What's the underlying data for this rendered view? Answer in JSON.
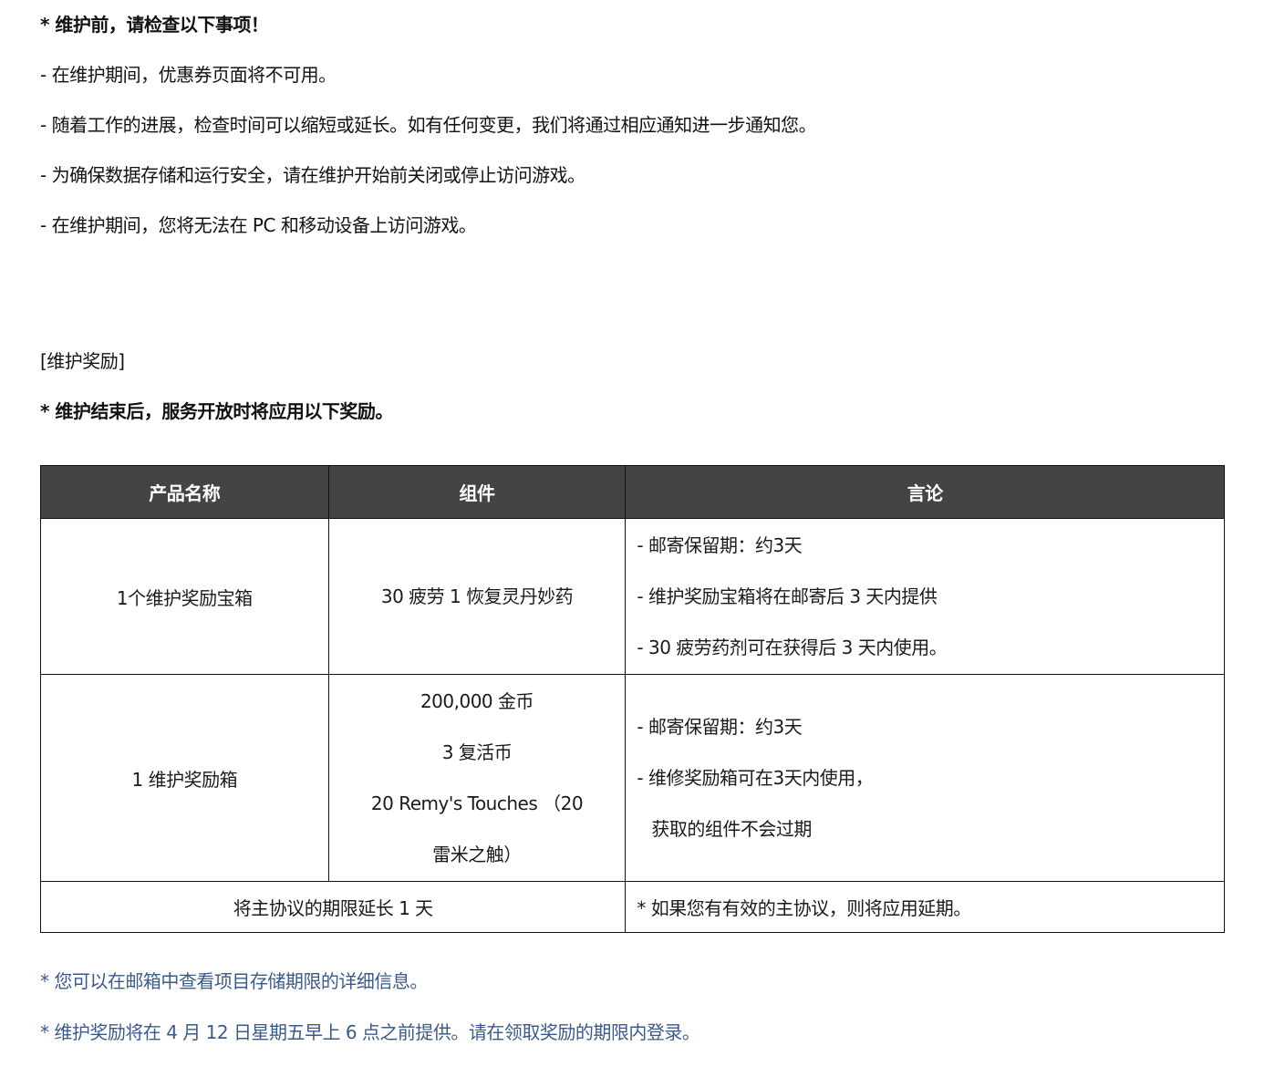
{
  "notice": {
    "heading": "* 维护前，请检查以下事项！",
    "items": [
      "- 在维护期间，优惠券页面将不可用。",
      "- 随着工作的进展，检查时间可以缩短或延长。如有任何变更，我们将通过相应通知进一步通知您。",
      "- 为确保数据存储和运行安全，请在维护开始前关闭或停止访问游戏。",
      "- 在维护期间，您将无法在 PC 和移动设备上访问游戏。"
    ]
  },
  "rewards": {
    "section_title": "[维护奖励]",
    "intro": "* 维护结束后，服务开放时将应用以下奖励。",
    "table": {
      "headers": [
        "产品名称",
        "组件",
        "言论"
      ],
      "rows": [
        {
          "product": "1个维护奖励宝箱",
          "components": [
            "30 疲劳 1 恢复灵丹妙药"
          ],
          "notes": [
            "- 邮寄保留期：约3天",
            "- 维护奖励宝箱将在邮寄后 3 天内提供",
            "- 30 疲劳药剂可在获得后 3 天内使用。"
          ]
        },
        {
          "product": "1 维护奖励箱",
          "components": [
            "200,000 金币",
            "3 复活币",
            "20 Remy's Touches （20",
            "雷米之触）"
          ],
          "notes": [
            "- 邮寄保留期：约3天",
            "- 维修奖励箱可在3天内使用，",
            "获取的组件不会过期"
          ]
        },
        {
          "product": "将主协议的期限延长 1 天",
          "notes": [
            "* 如果您有有效的主协议，则将应用延期。"
          ]
        }
      ]
    }
  },
  "footnotes": [
    "* 您可以在邮箱中查看项目存储期限的详细信息。",
    "* 维护奖励将在 4 月 12 日星期五早上 6 点之前提供。请在领取奖励的期限内登录。"
  ],
  "colors": {
    "header_bg": "#444444",
    "footnote_text": "#3b5a8c"
  }
}
